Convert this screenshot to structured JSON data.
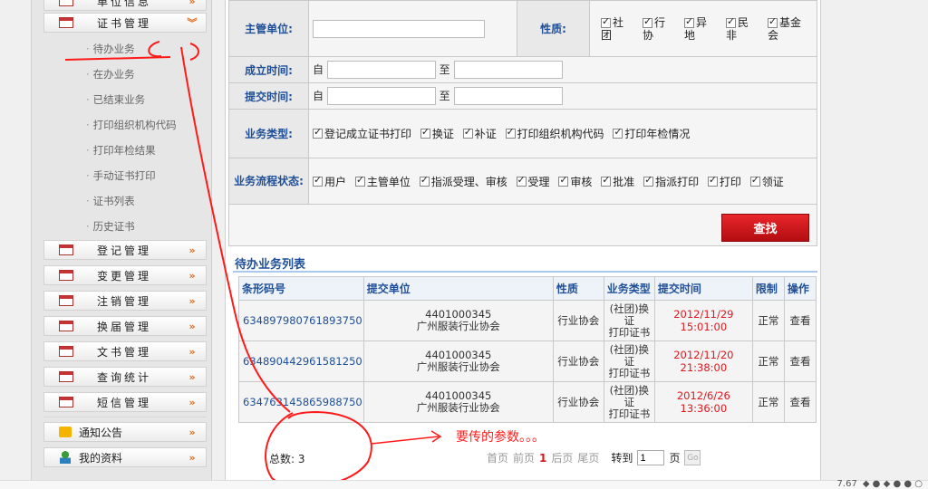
{
  "sidebar": {
    "top_partial": "单位信息",
    "cert_manage": "证书管理",
    "sub_items": [
      "待办业务",
      "在办业务",
      "已结束业务",
      "打印组织机构代码",
      "打印年检结果",
      "手动证书打印",
      "证书列表",
      "历史证书"
    ],
    "menus": [
      "登记管理",
      "变更管理",
      "注销管理",
      "换届管理",
      "文书管理",
      "查询统计",
      "短信管理"
    ],
    "notice": "通知公告",
    "profile": "我的资料"
  },
  "form": {
    "supervisor_label": "主管单位:",
    "nature_label": "性质:",
    "nature_options": [
      "社团",
      "行协",
      "异地",
      "民非",
      "基金会"
    ],
    "established_label": "成立时间:",
    "submitted_label": "提交时间:",
    "from": "自",
    "to": "至",
    "btype_label": "业务类型:",
    "btype_options": [
      "登记成立证书打印",
      "换证",
      "补证",
      "打印组织机构代码",
      "打印年检情况"
    ],
    "flow_label": "业务流程状态:",
    "flow_options": [
      "用户",
      "主管单位",
      "指派受理、审核",
      "受理",
      "审核",
      "批准",
      "指派打印",
      "打印",
      "领证"
    ],
    "search_button": "查找"
  },
  "list": {
    "title": "待办业务列表",
    "columns": [
      "条形码号",
      "提交单位",
      "性质",
      "业务类型",
      "提交时间",
      "限制",
      "操作"
    ],
    "rows": [
      {
        "barcode": "634897980761893750",
        "unit_code": "4401000345",
        "unit_name": "广州服装行业协会",
        "nature": "行业协会",
        "btype1": "(社团)换证",
        "btype2": "打印证书",
        "time1": "2012/11/29",
        "time2": "15:01:00",
        "limit": "正常",
        "action": "查看"
      },
      {
        "barcode": "634890442961581250",
        "unit_code": "4401000345",
        "unit_name": "广州服装行业协会",
        "nature": "行业协会",
        "btype1": "(社团)换证",
        "btype2": "打印证书",
        "time1": "2012/11/20",
        "time2": "21:38:00",
        "limit": "正常",
        "action": "查看"
      },
      {
        "barcode": "634763145865988750",
        "unit_code": "4401000345",
        "unit_name": "广州服装行业协会",
        "nature": "行业协会",
        "btype1": "(社团)换证",
        "btype2": "打印证书",
        "time1": "2012/6/26 13:36:00",
        "time2": "",
        "limit": "正常",
        "action": "查看"
      }
    ],
    "total_label": "总数:",
    "total_value": "3"
  },
  "pager": {
    "first": "首页",
    "prev": "前页",
    "current": "1",
    "next": "后页",
    "last": "尾页",
    "goto": "转到",
    "goto_value": "1",
    "page_unit": "页",
    "go": "Go"
  },
  "annotation": "要传的参数。。。",
  "status": {
    "speed": "7.67"
  }
}
